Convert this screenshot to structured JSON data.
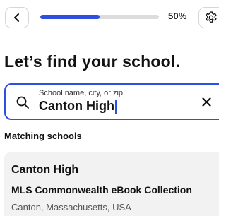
{
  "header": {
    "progress_value": 0.5,
    "progress_label": "50%",
    "accent_color": "#2f4fe0",
    "back_icon": "chevron-left-icon",
    "settings_icon": "gear-icon"
  },
  "title": "Let’s find your school.",
  "search": {
    "placeholder": "School name, city, or zip",
    "value": "Canton High",
    "search_icon": "search-icon",
    "clear_icon": "close-icon"
  },
  "results": {
    "heading": "Matching schools",
    "items": [
      {
        "name": "Canton High",
        "collection": "MLS Commonwealth eBook Collection",
        "location": "Canton, Massachusetts, USA"
      }
    ]
  }
}
